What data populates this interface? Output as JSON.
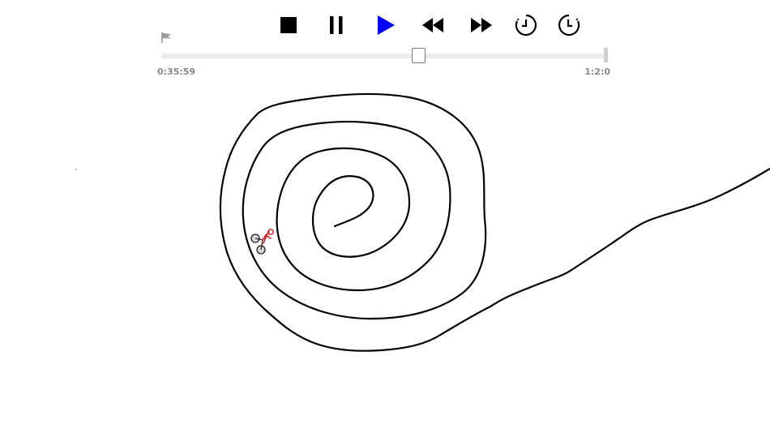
{
  "player": {
    "time_current": "0:35:59",
    "time_total": "1:2:0",
    "progress_fraction": 0.58,
    "accent_color": "#0000ff",
    "icons": {
      "stop": "stop-icon",
      "pause": "pause-icon",
      "play": "play-icon",
      "rewind": "rewind-icon",
      "fast_forward": "fast-forward-icon",
      "history_back": "history-back-icon",
      "history_forward": "history-forward-icon",
      "checkpoint": "checkpoint-flag-icon"
    }
  },
  "scene": {
    "rider": "bike-rider",
    "track_color": "#000000"
  }
}
